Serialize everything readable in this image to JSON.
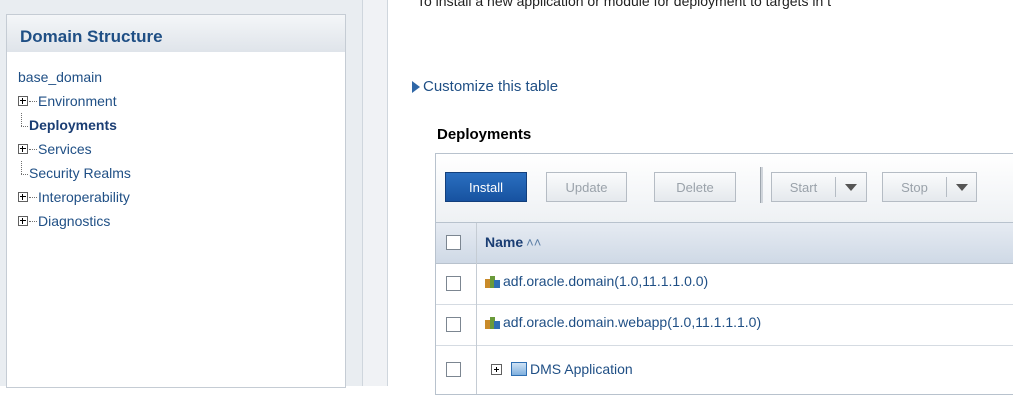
{
  "left_panel": {
    "title": "Domain Structure",
    "root": "base_domain",
    "items": [
      {
        "label": "Environment",
        "expandable": true,
        "bold": false
      },
      {
        "label": "Deployments",
        "expandable": false,
        "bold": true
      },
      {
        "label": "Services",
        "expandable": true,
        "bold": false
      },
      {
        "label": "Security Realms",
        "expandable": false,
        "bold": false
      },
      {
        "label": "Interoperability",
        "expandable": true,
        "bold": false
      },
      {
        "label": "Diagnostics",
        "expandable": true,
        "bold": false
      }
    ]
  },
  "main": {
    "intro_text": "To install a new application or module for deployment to targets in t",
    "customize_link": "Customize this table",
    "section_title": "Deployments",
    "toolbar": {
      "install": "Install",
      "update": "Update",
      "delete": "Delete",
      "start": "Start",
      "stop": "Stop"
    },
    "table": {
      "name_header": "Name",
      "sort_icon": "sort-ascending-icon",
      "rows": [
        {
          "name": "adf.oracle.domain(1.0,11.1.1.0.0)",
          "icon": "library-icon"
        },
        {
          "name": "adf.oracle.domain.webapp(1.0,11.1.1.1.0)",
          "icon": "library-icon"
        },
        {
          "name": "DMS Application",
          "icon": "application-icon"
        }
      ]
    }
  },
  "colors": {
    "primary_button": "#1752a0",
    "link": "#1f4f85",
    "header_bg": "#cfd9e6"
  }
}
